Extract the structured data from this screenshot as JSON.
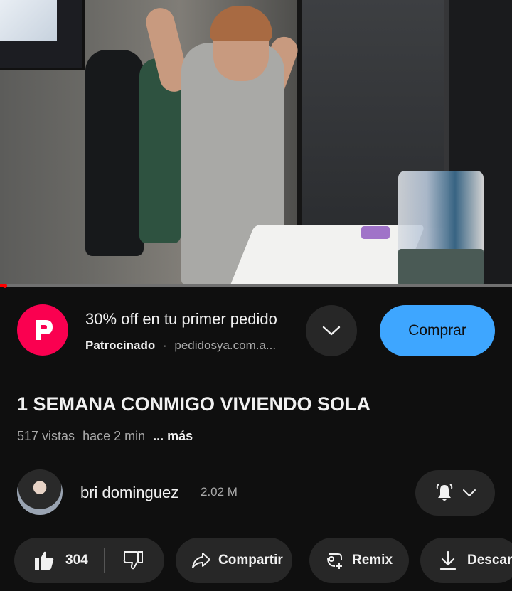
{
  "ad": {
    "title": "30% off en tu primer pedido",
    "sponsored_label": "Patrocinado",
    "separator": "·",
    "domain": "pedidosya.com.a...",
    "cta_label": "Comprar",
    "logo_letter": "P",
    "logo_color": "#fa0050",
    "cta_color": "#3ea6ff"
  },
  "video": {
    "title": "1 SEMANA CONMIGO VIVIENDO SOLA",
    "views": "517 vistas",
    "time_ago": "hace 2 min",
    "more_label": "... más",
    "progress": 0.01
  },
  "channel": {
    "name": "bri dominguez",
    "subscribers": "2.02 M"
  },
  "actions": {
    "like_count": "304",
    "share_label": "Compartir",
    "remix_label": "Remix",
    "download_label": "Descar"
  },
  "icons": {
    "like": "thumbs-up-icon",
    "dislike": "thumbs-down-icon",
    "share": "share-arrow-icon",
    "remix": "remix-icon",
    "download": "download-icon",
    "bell": "bell-icon",
    "chevron": "chevron-down-icon"
  }
}
